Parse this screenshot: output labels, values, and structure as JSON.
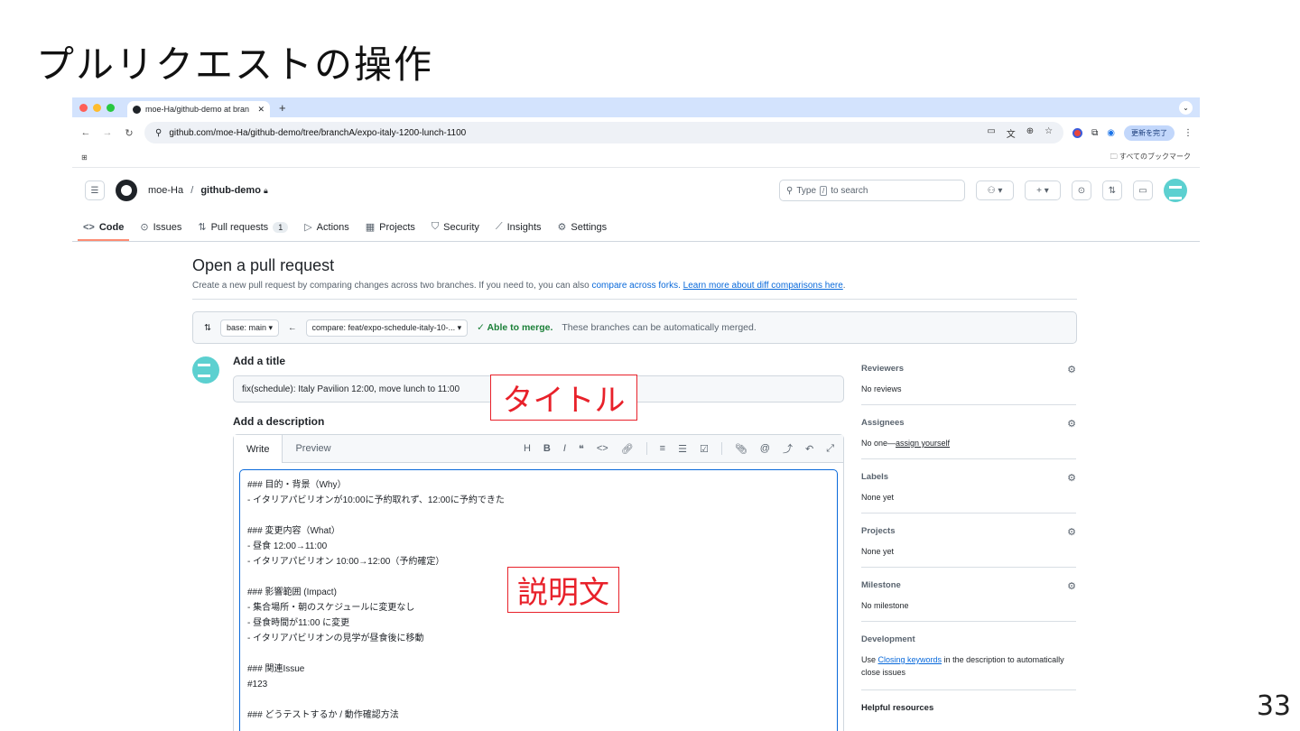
{
  "slide": {
    "title": "プルリクエストの操作",
    "number": "33"
  },
  "browser": {
    "tab_title": "moe-Ha/github-demo at bran",
    "new_tab": "+",
    "url": "github.com/moe-Ha/github-demo/tree/branchA/expo-italy-1200-lunch-1100",
    "update_label": "更新を完了",
    "bookmarks_label": "すべてのブックマーク"
  },
  "github": {
    "owner": "moe-Ha",
    "separator": "/",
    "repo": "github-demo",
    "search_prefix": "Type",
    "search_key": "/",
    "search_suffix": "to search",
    "nav": [
      {
        "icon": "<>",
        "label": "Code"
      },
      {
        "icon": "⊙",
        "label": "Issues"
      },
      {
        "icon": "⇅",
        "label": "Pull requests",
        "count": "1"
      },
      {
        "icon": "▷",
        "label": "Actions"
      },
      {
        "icon": "▦",
        "label": "Projects"
      },
      {
        "icon": "⛉",
        "label": "Security"
      },
      {
        "icon": "⟋",
        "label": "Insights"
      },
      {
        "icon": "⚙",
        "label": "Settings"
      }
    ]
  },
  "page": {
    "heading": "Open a pull request",
    "sub_text": "Create a new pull request by comparing changes across two branches. If you need to, you can also",
    "sub_link1": "compare across forks.",
    "sub_link2": "Learn more about diff comparisons here",
    "sub_end": ".",
    "base_branch": "base: main ▾",
    "compare_branch": "compare: feat/expo-schedule-italy-10-... ▾",
    "merge_ok": "✓ Able to merge.",
    "merge_msg": "These branches can be automatically merged."
  },
  "form": {
    "title_label": "Add a title",
    "title_value": "fix(schedule): Italy Pavilion 12:00, move lunch to 11:00",
    "desc_label": "Add a description",
    "tab_write": "Write",
    "tab_preview": "Preview",
    "description": "### 目的・背景（Why）\n- イタリアパビリオンが10:00に予約取れず、12:00に予約できた\n\n### 変更内容（What）\n- 昼食 12:00→11:00\n- イタリアパビリオン 10:00→12:00（予約確定）\n\n### 影響範囲 (Impact)\n- 集合場所・朝のスケジュールに変更なし\n- 昼食時間が11:00 に変更\n- イタリアパビリオンの見学が昼食後に移動\n\n### 関連Issue\n#123\n\n### どうテストするか / 動作確認方法"
  },
  "sidebar": {
    "reviewers": {
      "label": "Reviewers",
      "value": "No reviews"
    },
    "assignees": {
      "label": "Assignees",
      "value_prefix": "No one—",
      "value_link": "assign yourself"
    },
    "labels": {
      "label": "Labels",
      "value": "None yet"
    },
    "projects": {
      "label": "Projects",
      "value": "None yet"
    },
    "milestone": {
      "label": "Milestone",
      "value": "No milestone"
    },
    "development": {
      "label": "Development",
      "prefix": "Use",
      "link": "Closing keywords",
      "suffix": "in the description to automatically close issues"
    },
    "helpful": {
      "label": "Helpful resources"
    }
  },
  "annotations": {
    "title_box": "タイトル",
    "desc_box": "説明文"
  },
  "colors": {
    "accent": "#0969da",
    "success": "#1a7f37",
    "annotation": "#e8212a",
    "tab_strip": "#d3e3fd"
  }
}
